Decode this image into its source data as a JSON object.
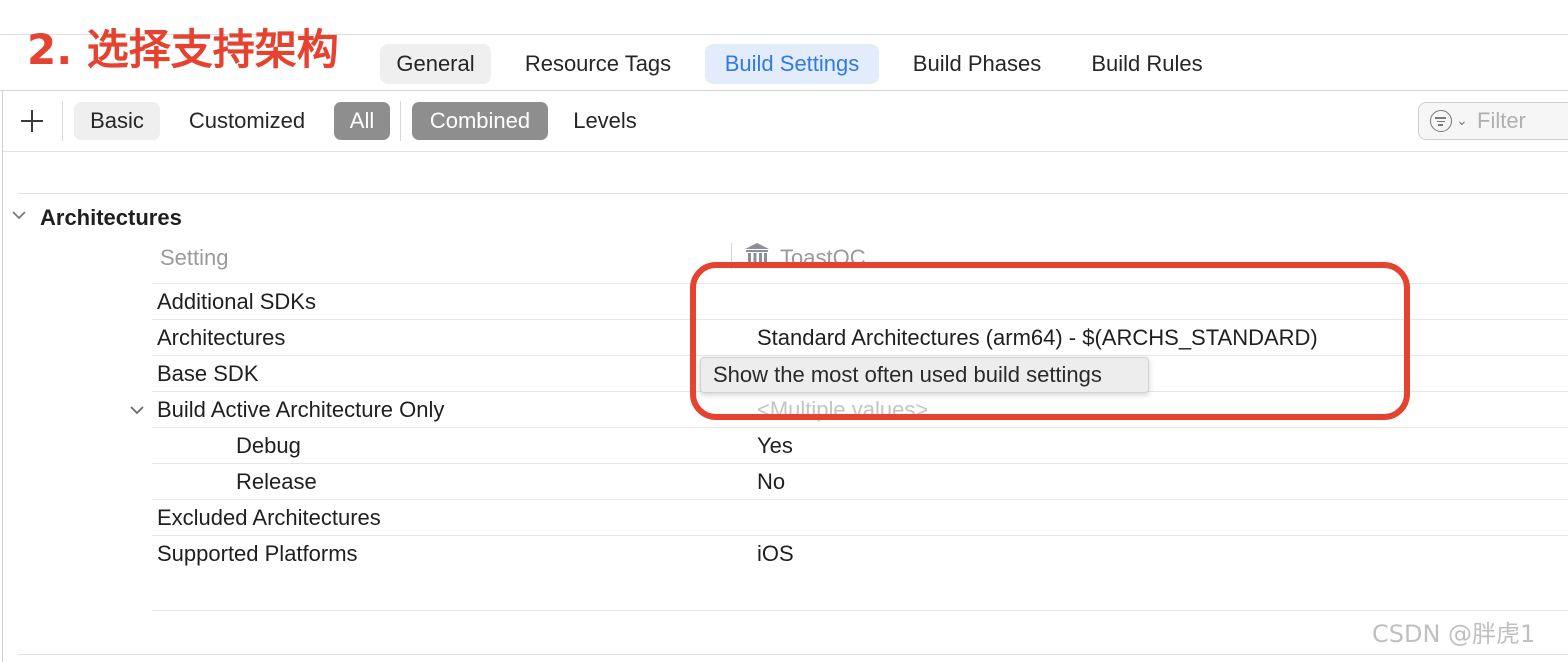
{
  "annotation": {
    "title": "2. 选择支持架构",
    "color": "#e5432f"
  },
  "tabs": [
    {
      "label": "General",
      "selected": false
    },
    {
      "label": "Resource Tags",
      "selected": false
    },
    {
      "label": "Build Settings",
      "selected": true
    },
    {
      "label": "Build Phases",
      "selected": false
    },
    {
      "label": "Build Rules",
      "selected": false
    }
  ],
  "toolbar": {
    "add_icon": "plus-icon",
    "segments_view": [
      {
        "label": "Basic",
        "selected": false
      },
      {
        "label": "Customized",
        "selected": false
      },
      {
        "label": "All",
        "selected": true
      }
    ],
    "segments_mode": [
      {
        "label": "Combined",
        "selected": true
      },
      {
        "label": "Levels",
        "selected": false
      }
    ],
    "filter": {
      "icon": "filter-icon",
      "placeholder": "Filter"
    }
  },
  "section": {
    "title": "Architectures",
    "expanded": true
  },
  "columns": {
    "setting": "Setting",
    "target": "ToastOC",
    "target_icon": "target-building-icon"
  },
  "rows": [
    {
      "name": "Additional SDKs",
      "value": ""
    },
    {
      "name": "Architectures",
      "value": "Standard Architectures (arm64)  -  $(ARCHS_STANDARD)"
    },
    {
      "name": "Base SDK",
      "value": ""
    },
    {
      "name": "Build Active Architecture Only",
      "value": "<Multiple values>",
      "expanded": true
    },
    {
      "name": "Debug",
      "value": "Yes"
    },
    {
      "name": "Release",
      "value": "No"
    },
    {
      "name": "Excluded Architectures",
      "value": ""
    },
    {
      "name": "Supported Platforms",
      "value": "iOS"
    }
  ],
  "tooltip": {
    "text": "Show the most often used build settings"
  },
  "watermark": "CSDN @胖虎1",
  "colors": {
    "accent": "#2f7ae5",
    "selected_segment": "#8e8e8e",
    "annotation_red": "#e5432f"
  }
}
